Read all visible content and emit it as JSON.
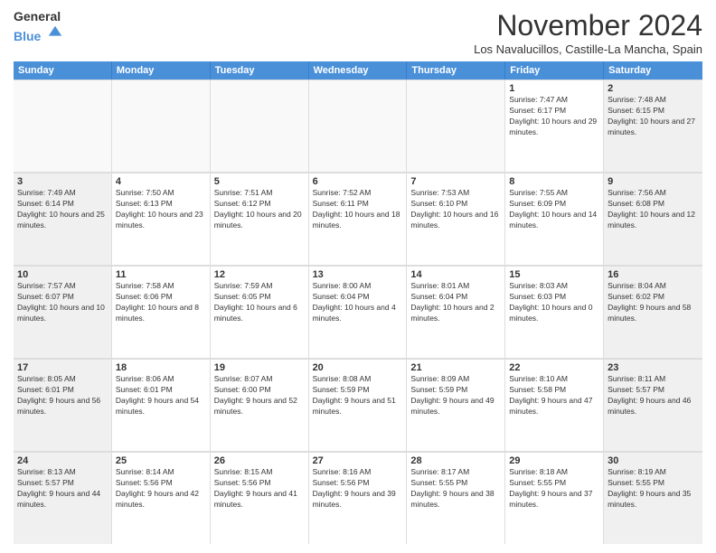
{
  "header": {
    "logo_general": "General",
    "logo_blue": "Blue",
    "month_title": "November 2024",
    "location": "Los Navalucillos, Castille-La Mancha, Spain"
  },
  "weekdays": [
    "Sunday",
    "Monday",
    "Tuesday",
    "Wednesday",
    "Thursday",
    "Friday",
    "Saturday"
  ],
  "weeks": [
    [
      {
        "day": "",
        "info": "",
        "empty": true
      },
      {
        "day": "",
        "info": "",
        "empty": true
      },
      {
        "day": "",
        "info": "",
        "empty": true
      },
      {
        "day": "",
        "info": "",
        "empty": true
      },
      {
        "day": "",
        "info": "",
        "empty": true
      },
      {
        "day": "1",
        "info": "Sunrise: 7:47 AM\nSunset: 6:17 PM\nDaylight: 10 hours and 29 minutes."
      },
      {
        "day": "2",
        "info": "Sunrise: 7:48 AM\nSunset: 6:15 PM\nDaylight: 10 hours and 27 minutes."
      }
    ],
    [
      {
        "day": "3",
        "info": "Sunrise: 7:49 AM\nSunset: 6:14 PM\nDaylight: 10 hours and 25 minutes."
      },
      {
        "day": "4",
        "info": "Sunrise: 7:50 AM\nSunset: 6:13 PM\nDaylight: 10 hours and 23 minutes."
      },
      {
        "day": "5",
        "info": "Sunrise: 7:51 AM\nSunset: 6:12 PM\nDaylight: 10 hours and 20 minutes."
      },
      {
        "day": "6",
        "info": "Sunrise: 7:52 AM\nSunset: 6:11 PM\nDaylight: 10 hours and 18 minutes."
      },
      {
        "day": "7",
        "info": "Sunrise: 7:53 AM\nSunset: 6:10 PM\nDaylight: 10 hours and 16 minutes."
      },
      {
        "day": "8",
        "info": "Sunrise: 7:55 AM\nSunset: 6:09 PM\nDaylight: 10 hours and 14 minutes."
      },
      {
        "day": "9",
        "info": "Sunrise: 7:56 AM\nSunset: 6:08 PM\nDaylight: 10 hours and 12 minutes."
      }
    ],
    [
      {
        "day": "10",
        "info": "Sunrise: 7:57 AM\nSunset: 6:07 PM\nDaylight: 10 hours and 10 minutes."
      },
      {
        "day": "11",
        "info": "Sunrise: 7:58 AM\nSunset: 6:06 PM\nDaylight: 10 hours and 8 minutes."
      },
      {
        "day": "12",
        "info": "Sunrise: 7:59 AM\nSunset: 6:05 PM\nDaylight: 10 hours and 6 minutes."
      },
      {
        "day": "13",
        "info": "Sunrise: 8:00 AM\nSunset: 6:04 PM\nDaylight: 10 hours and 4 minutes."
      },
      {
        "day": "14",
        "info": "Sunrise: 8:01 AM\nSunset: 6:04 PM\nDaylight: 10 hours and 2 minutes."
      },
      {
        "day": "15",
        "info": "Sunrise: 8:03 AM\nSunset: 6:03 PM\nDaylight: 10 hours and 0 minutes."
      },
      {
        "day": "16",
        "info": "Sunrise: 8:04 AM\nSunset: 6:02 PM\nDaylight: 9 hours and 58 minutes."
      }
    ],
    [
      {
        "day": "17",
        "info": "Sunrise: 8:05 AM\nSunset: 6:01 PM\nDaylight: 9 hours and 56 minutes."
      },
      {
        "day": "18",
        "info": "Sunrise: 8:06 AM\nSunset: 6:01 PM\nDaylight: 9 hours and 54 minutes."
      },
      {
        "day": "19",
        "info": "Sunrise: 8:07 AM\nSunset: 6:00 PM\nDaylight: 9 hours and 52 minutes."
      },
      {
        "day": "20",
        "info": "Sunrise: 8:08 AM\nSunset: 5:59 PM\nDaylight: 9 hours and 51 minutes."
      },
      {
        "day": "21",
        "info": "Sunrise: 8:09 AM\nSunset: 5:59 PM\nDaylight: 9 hours and 49 minutes."
      },
      {
        "day": "22",
        "info": "Sunrise: 8:10 AM\nSunset: 5:58 PM\nDaylight: 9 hours and 47 minutes."
      },
      {
        "day": "23",
        "info": "Sunrise: 8:11 AM\nSunset: 5:57 PM\nDaylight: 9 hours and 46 minutes."
      }
    ],
    [
      {
        "day": "24",
        "info": "Sunrise: 8:13 AM\nSunset: 5:57 PM\nDaylight: 9 hours and 44 minutes."
      },
      {
        "day": "25",
        "info": "Sunrise: 8:14 AM\nSunset: 5:56 PM\nDaylight: 9 hours and 42 minutes."
      },
      {
        "day": "26",
        "info": "Sunrise: 8:15 AM\nSunset: 5:56 PM\nDaylight: 9 hours and 41 minutes."
      },
      {
        "day": "27",
        "info": "Sunrise: 8:16 AM\nSunset: 5:56 PM\nDaylight: 9 hours and 39 minutes."
      },
      {
        "day": "28",
        "info": "Sunrise: 8:17 AM\nSunset: 5:55 PM\nDaylight: 9 hours and 38 minutes."
      },
      {
        "day": "29",
        "info": "Sunrise: 8:18 AM\nSunset: 5:55 PM\nDaylight: 9 hours and 37 minutes."
      },
      {
        "day": "30",
        "info": "Sunrise: 8:19 AM\nSunset: 5:55 PM\nDaylight: 9 hours and 35 minutes."
      }
    ]
  ]
}
